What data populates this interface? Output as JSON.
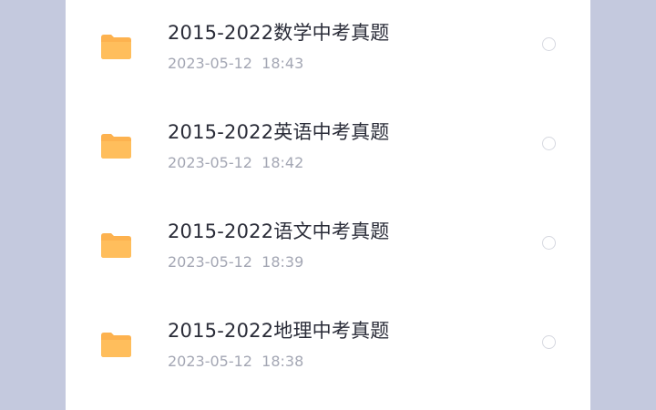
{
  "colors": {
    "background_side": "#c4c9de",
    "panel": "#ffffff",
    "folder": "#fdb24f",
    "title_text": "#2a2c38",
    "date_text": "#a4a7b4",
    "radio_border": "#d6d8e0"
  },
  "files": [
    {
      "name": "2015-2022数学中考真题",
      "date": "2023-05-12  18:43",
      "icon": "folder-icon"
    },
    {
      "name": "2015-2022英语中考真题",
      "date": "2023-05-12  18:42",
      "icon": "folder-icon"
    },
    {
      "name": "2015-2022语文中考真题",
      "date": "2023-05-12  18:39",
      "icon": "folder-icon"
    },
    {
      "name": "2015-2022地理中考真题",
      "date": "2023-05-12  18:38",
      "icon": "folder-icon"
    }
  ]
}
